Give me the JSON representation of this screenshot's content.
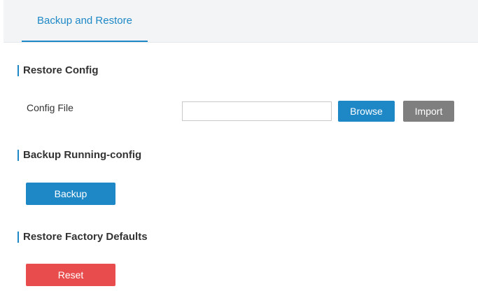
{
  "tabs": [
    {
      "label": "Backup and Restore",
      "active": true
    }
  ],
  "restore_config": {
    "title": "Restore Config",
    "config_file_label": "Config File",
    "config_file_value": "",
    "browse_label": "Browse",
    "import_label": "Import"
  },
  "backup_running": {
    "title": "Backup Running-config",
    "backup_label": "Backup"
  },
  "factory_defaults": {
    "title": "Restore Factory Defaults",
    "reset_label": "Reset"
  },
  "colors": {
    "accent": "#1e88c7",
    "import_button": "#7f7f7f",
    "reset_button": "#e84c4c",
    "tabbar_background": "#f2f4f5"
  }
}
